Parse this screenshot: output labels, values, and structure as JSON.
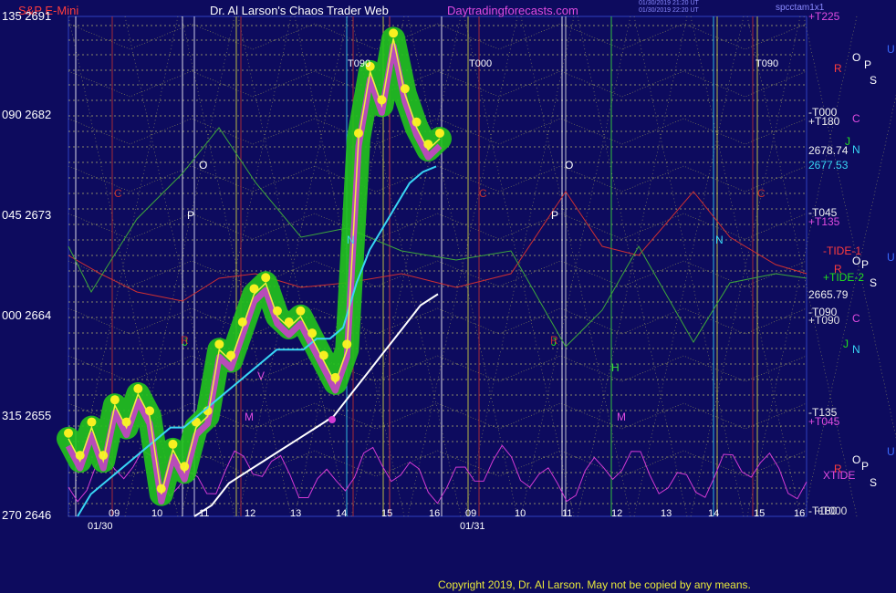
{
  "header": {
    "instrument": "S&P E-Mini",
    "title": "Dr. Al Larson's Chaos Trader Web",
    "site": "Daytradingforecasts.com",
    "stamp1": "01/30/2019 21:20 UT",
    "stamp2": "01/30/2019 22:20 UT",
    "program": "spcctam1x1"
  },
  "y_axis": [
    {
      "code": "135",
      "price": "2691"
    },
    {
      "code": "090",
      "price": "2682"
    },
    {
      "code": "045",
      "price": "2673"
    },
    {
      "code": "000",
      "price": "2664"
    },
    {
      "code": "315",
      "price": "2655"
    },
    {
      "code": "270",
      "price": "2646"
    }
  ],
  "x_axis": {
    "ticks_day1": [
      "09",
      "10",
      "11",
      "12",
      "13",
      "14",
      "15",
      "16"
    ],
    "ticks_day2": [
      "09",
      "10",
      "11",
      "12",
      "13",
      "14",
      "15",
      "16"
    ],
    "date1": "01/30",
    "date2": "01/31"
  },
  "right_labels": {
    "t225": "+T225",
    "t000": "-T000",
    "t180": "+T180",
    "price_a": "2678.74",
    "price_b": "2677.53",
    "t045": "-T045",
    "t135": "+T135",
    "tide1": "-TIDE-1",
    "tide2": "+TIDE-2",
    "price_c": "2665.79",
    "t090": "-T090",
    "t090b": "+T090",
    "t135b": "-T135",
    "t045b": "+T045",
    "xtide": "XTIDE",
    "t180b": "-T180",
    "t000b": "+T000"
  },
  "planet_letters": {
    "O": "O",
    "P": "P",
    "S": "S",
    "U": "U",
    "R": "R",
    "C": "C",
    "J": "J",
    "N": "N",
    "M": "M",
    "V": "V",
    "H": "H"
  },
  "chart_labels": {
    "t090": "T090",
    "t000": "T000",
    "t090b": "T090"
  },
  "copyright": "Copyright 2019, Dr. Al Larson. May not be copied by any means.",
  "colors": {
    "background": "#0d0b5e",
    "price": "#f2f23a",
    "average": "#38d6f5",
    "trend": "#ffffff",
    "green_band": "#22c41c",
    "dots": "#f7f020",
    "magenta": "#d43ad4",
    "grid": "#d8d870",
    "red": "#d03030"
  },
  "chart_data": {
    "type": "line",
    "title": "S&P E-Mini",
    "ylim": [
      2646,
      2691
    ],
    "x_range": [
      "01/30 09:00",
      "01/31 16:00"
    ],
    "series": [
      {
        "name": "price",
        "values": [
          2653,
          2651,
          2654,
          2651,
          2656,
          2654,
          2657,
          2655,
          2648,
          2652,
          2650,
          2654,
          2655,
          2661,
          2660,
          2663,
          2666,
          2667,
          2664,
          2663,
          2664,
          2662,
          2660,
          2658,
          2661,
          2680,
          2686,
          2683,
          2689,
          2684,
          2681,
          2679,
          2680
        ]
      },
      {
        "name": "average",
        "values": [
          2646,
          2648,
          2649,
          2650,
          2651,
          2652,
          2653,
          2654,
          2654,
          2655,
          2656,
          2657,
          2658,
          2659,
          2660,
          2661,
          2661,
          2661,
          2662,
          2662,
          2663,
          2667,
          2670,
          2672,
          2674,
          2676,
          2677,
          2677.5
        ]
      },
      {
        "name": "trend",
        "values": [
          2646,
          2647,
          2649,
          2650,
          2651,
          2652,
          2653,
          2654,
          2655,
          2657,
          2659,
          2661,
          2663,
          2665,
          2666
        ]
      }
    ]
  }
}
